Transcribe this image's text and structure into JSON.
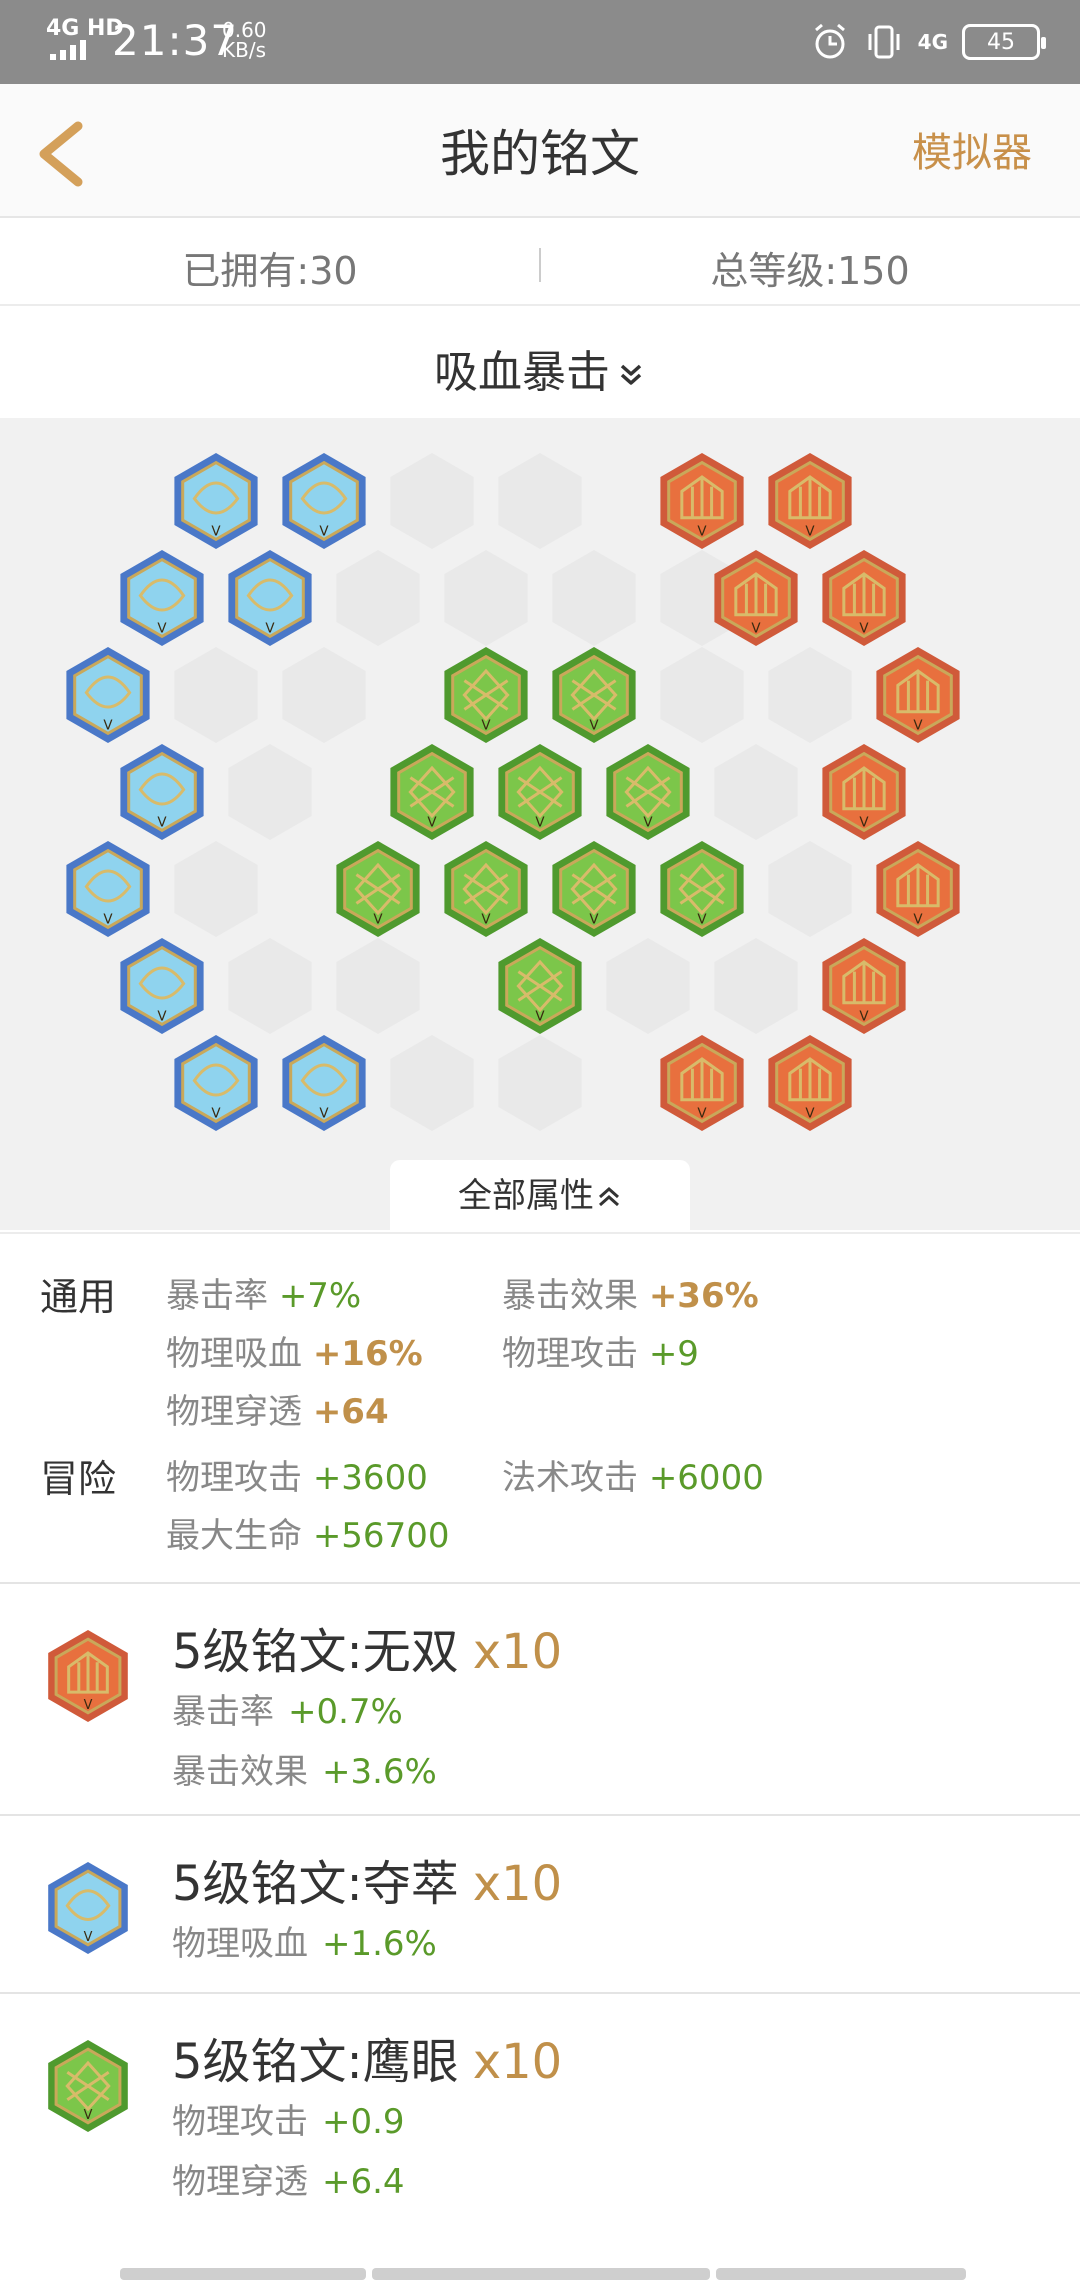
{
  "status_bar": {
    "network": "4G HD",
    "time": "21:37",
    "speed_value": "0.60",
    "speed_unit": "KB/s",
    "net_right": "4G",
    "battery": "45"
  },
  "header": {
    "title": "我的铭文",
    "simulator_label": "模拟器"
  },
  "summary": {
    "owned": "已拥有:30",
    "total_level": "总等级:150"
  },
  "page_selector": {
    "name": "吸血暴击"
  },
  "board": {
    "all_attributes_label": "全部属性",
    "colors": {
      "blue": "#4a78c8",
      "blue_fill": "#8fd3ee",
      "green": "#4f9a2e",
      "green_fill": "#7cc64a",
      "red": "#d05a3a",
      "red_fill": "#e8703e",
      "empty": "#e9e9e9"
    }
  },
  "attributes": {
    "general": {
      "label": "通用",
      "items": [
        {
          "name": "暴击率",
          "value": "+7%"
        },
        {
          "name": "暴击效果",
          "value": "+36%"
        },
        {
          "name": "物理吸血",
          "value": "+16%"
        },
        {
          "name": "物理攻击",
          "value": "+9"
        },
        {
          "name": "物理穿透",
          "value": "+64"
        }
      ]
    },
    "adventure": {
      "label": "冒险",
      "items": [
        {
          "name": "物理攻击",
          "value": "+3600"
        },
        {
          "name": "法术攻击",
          "value": "+6000"
        },
        {
          "name": "最大生命",
          "value": "+56700"
        }
      ]
    }
  },
  "runes": [
    {
      "title": "5级铭文:无双",
      "count": "x10",
      "color": "red",
      "stats": [
        {
          "name": "暴击率",
          "value": "+0.7%"
        },
        {
          "name": "暴击效果",
          "value": "+3.6%"
        }
      ]
    },
    {
      "title": "5级铭文:夺萃",
      "count": "x10",
      "color": "blue",
      "stats": [
        {
          "name": "物理吸血",
          "value": "+1.6%"
        }
      ]
    },
    {
      "title": "5级铭文:鹰眼",
      "count": "x10",
      "color": "green",
      "stats": [
        {
          "name": "物理攻击",
          "value": "+0.9"
        },
        {
          "name": "物理穿透",
          "value": "+6.4"
        }
      ]
    }
  ]
}
